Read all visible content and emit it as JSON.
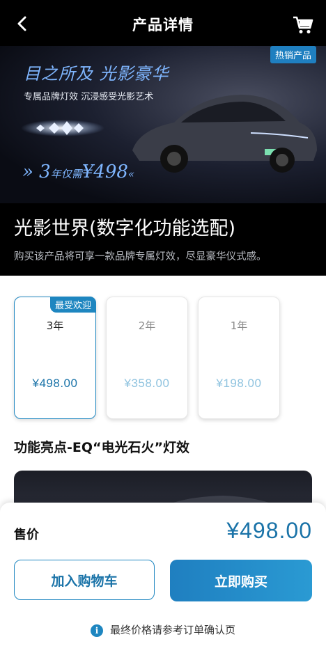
{
  "nav": {
    "title": "产品详情",
    "back_icon": "chevron-left-icon",
    "cart_icon": "cart-icon"
  },
  "banner": {
    "badge": "热销产品",
    "slogan": "目之所及 光影豪华",
    "sub_slogan": "专属品牌灯效 沉浸感受光影艺术",
    "price_prefix": "» 3",
    "price_mid": "年仅需",
    "price_value": "¥498",
    "price_suffix": "«"
  },
  "product": {
    "title": "光影世界(数字化功能选配)",
    "description": "购买该产品将可享一款品牌专属灯效，尽显豪华仪式感。"
  },
  "options": [
    {
      "period": "3年",
      "price": "¥498.00",
      "badge": "最受欢迎",
      "selected": true
    },
    {
      "period": "2年",
      "price": "¥358.00",
      "selected": false
    },
    {
      "period": "1年",
      "price": "¥198.00",
      "selected": false
    }
  ],
  "highlight": {
    "title": "功能亮点-EQ“电光石火”灯效"
  },
  "bottom": {
    "sale_label": "售价",
    "sale_price": "¥498.00",
    "add_to_cart": "加入购物车",
    "buy_now": "立即购买",
    "notice": "最终价格请参考订单确认页",
    "info_icon": "info-icon"
  },
  "colors": {
    "accent": "#1e86c0",
    "price": "#1a73a8",
    "header_bg": "#000000"
  }
}
